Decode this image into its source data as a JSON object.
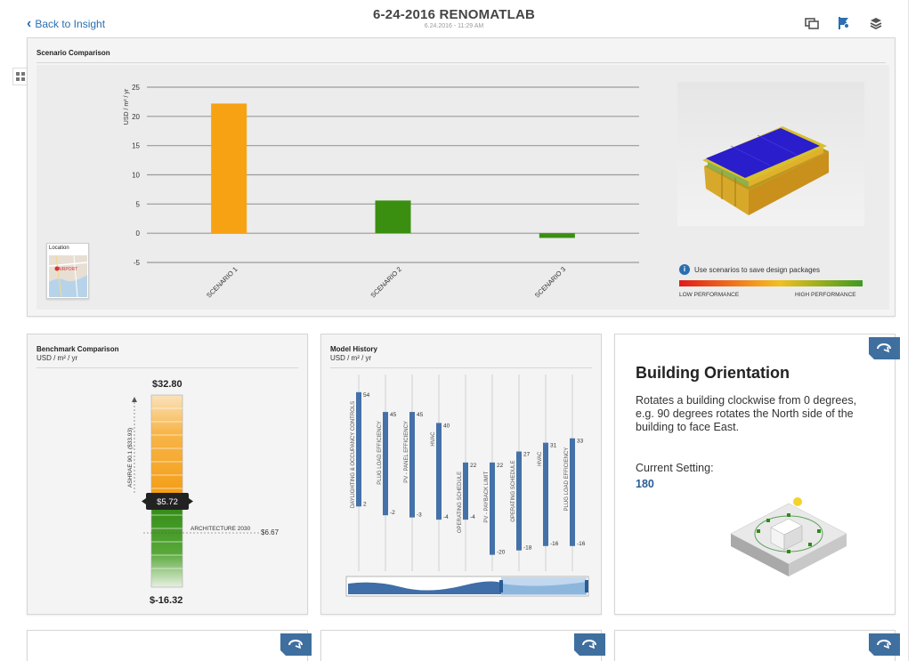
{
  "header": {
    "back_label": "Back to Insight",
    "title": "6-24-2016 RENOMATLAB",
    "subtitle": "6.24.2016 - 11:29 AM",
    "icons": [
      "compare-icon",
      "flag-icon",
      "layers-icon"
    ]
  },
  "scenario_panel": {
    "title": "Scenario Comparison",
    "location_label": "Location",
    "map_label": "AIRPORT",
    "hint": "Use scenarios to save design packages",
    "perf_low": "LOW PERFORMANCE",
    "perf_high": "HIGH PERFORMANCE"
  },
  "chart_data": {
    "type": "bar",
    "categories": [
      "SCENARIO 1",
      "SCENARIO 2",
      "SCENARIO 3"
    ],
    "values": [
      22.2,
      5.6,
      -0.8
    ],
    "colors": [
      "#f7a212",
      "#3a8f10",
      "#3a8f10"
    ],
    "ylabel": "USD / m² / yr",
    "yticks": [
      25,
      20,
      15,
      10,
      5,
      0,
      -5
    ],
    "ylim": [
      -5,
      25
    ],
    "grid": true
  },
  "benchmark": {
    "title": "Benchmark Comparison",
    "units": "USD / m² / yr",
    "top_value": "$32.80",
    "bottom_value": "$-16.32",
    "current_value": "$5.72",
    "ashrae_label": "ASHRAE 90.1 ($33.93)",
    "arch_label": "ARCHITECTURE 2030",
    "arch_value": "$6.67"
  },
  "history": {
    "title": "Model History",
    "units": "USD / m² / yr",
    "items": [
      {
        "label": "DAYLIGHTING & OCCUPANCY CONTROLS",
        "high": "54",
        "low": "2",
        "high_v": 54,
        "low_v": 2
      },
      {
        "label": "PLUG LOAD EFFICIENCY",
        "high": "45",
        "low": "-2",
        "high_v": 45,
        "low_v": -2
      },
      {
        "label": "PV - PANEL EFFICIENCY",
        "high": "45",
        "low": "-3",
        "high_v": 45,
        "low_v": -3
      },
      {
        "label": "HVAC",
        "high": "40",
        "low": "-4",
        "high_v": 40,
        "low_v": -4
      },
      {
        "label": "OPERATING SCHEDULE",
        "high": "22",
        "low": "-4",
        "high_v": 22,
        "low_v": -4
      },
      {
        "label": "PV - PAYBACK LIMIT",
        "high": "22",
        "low": "-20",
        "high_v": 22,
        "low_v": -20
      },
      {
        "label": "OPERATING SCHEDULE",
        "high": "27",
        "low": "-18",
        "high_v": 27,
        "low_v": -18
      },
      {
        "label": "HVAC",
        "high": "31",
        "low": "-16",
        "high_v": 31,
        "low_v": -16
      },
      {
        "label": "PLUG LOAD EFFICIENCY",
        "high": "33",
        "low": "-16",
        "high_v": 33,
        "low_v": -16
      }
    ]
  },
  "orientation": {
    "title": "Building Orientation",
    "description": "Rotates a building clockwise from 0 degrees, e.g. 90 degrees rotates the North side of the building to face East.",
    "current_label": "Current Setting:",
    "current_value": "180"
  },
  "colors": {
    "accent_blue": "#2a6fb0",
    "bar_orange": "#f7a212",
    "bar_green": "#3a8f10",
    "history_blue": "#4471a8",
    "badge_blue": "#3f6f9f"
  }
}
